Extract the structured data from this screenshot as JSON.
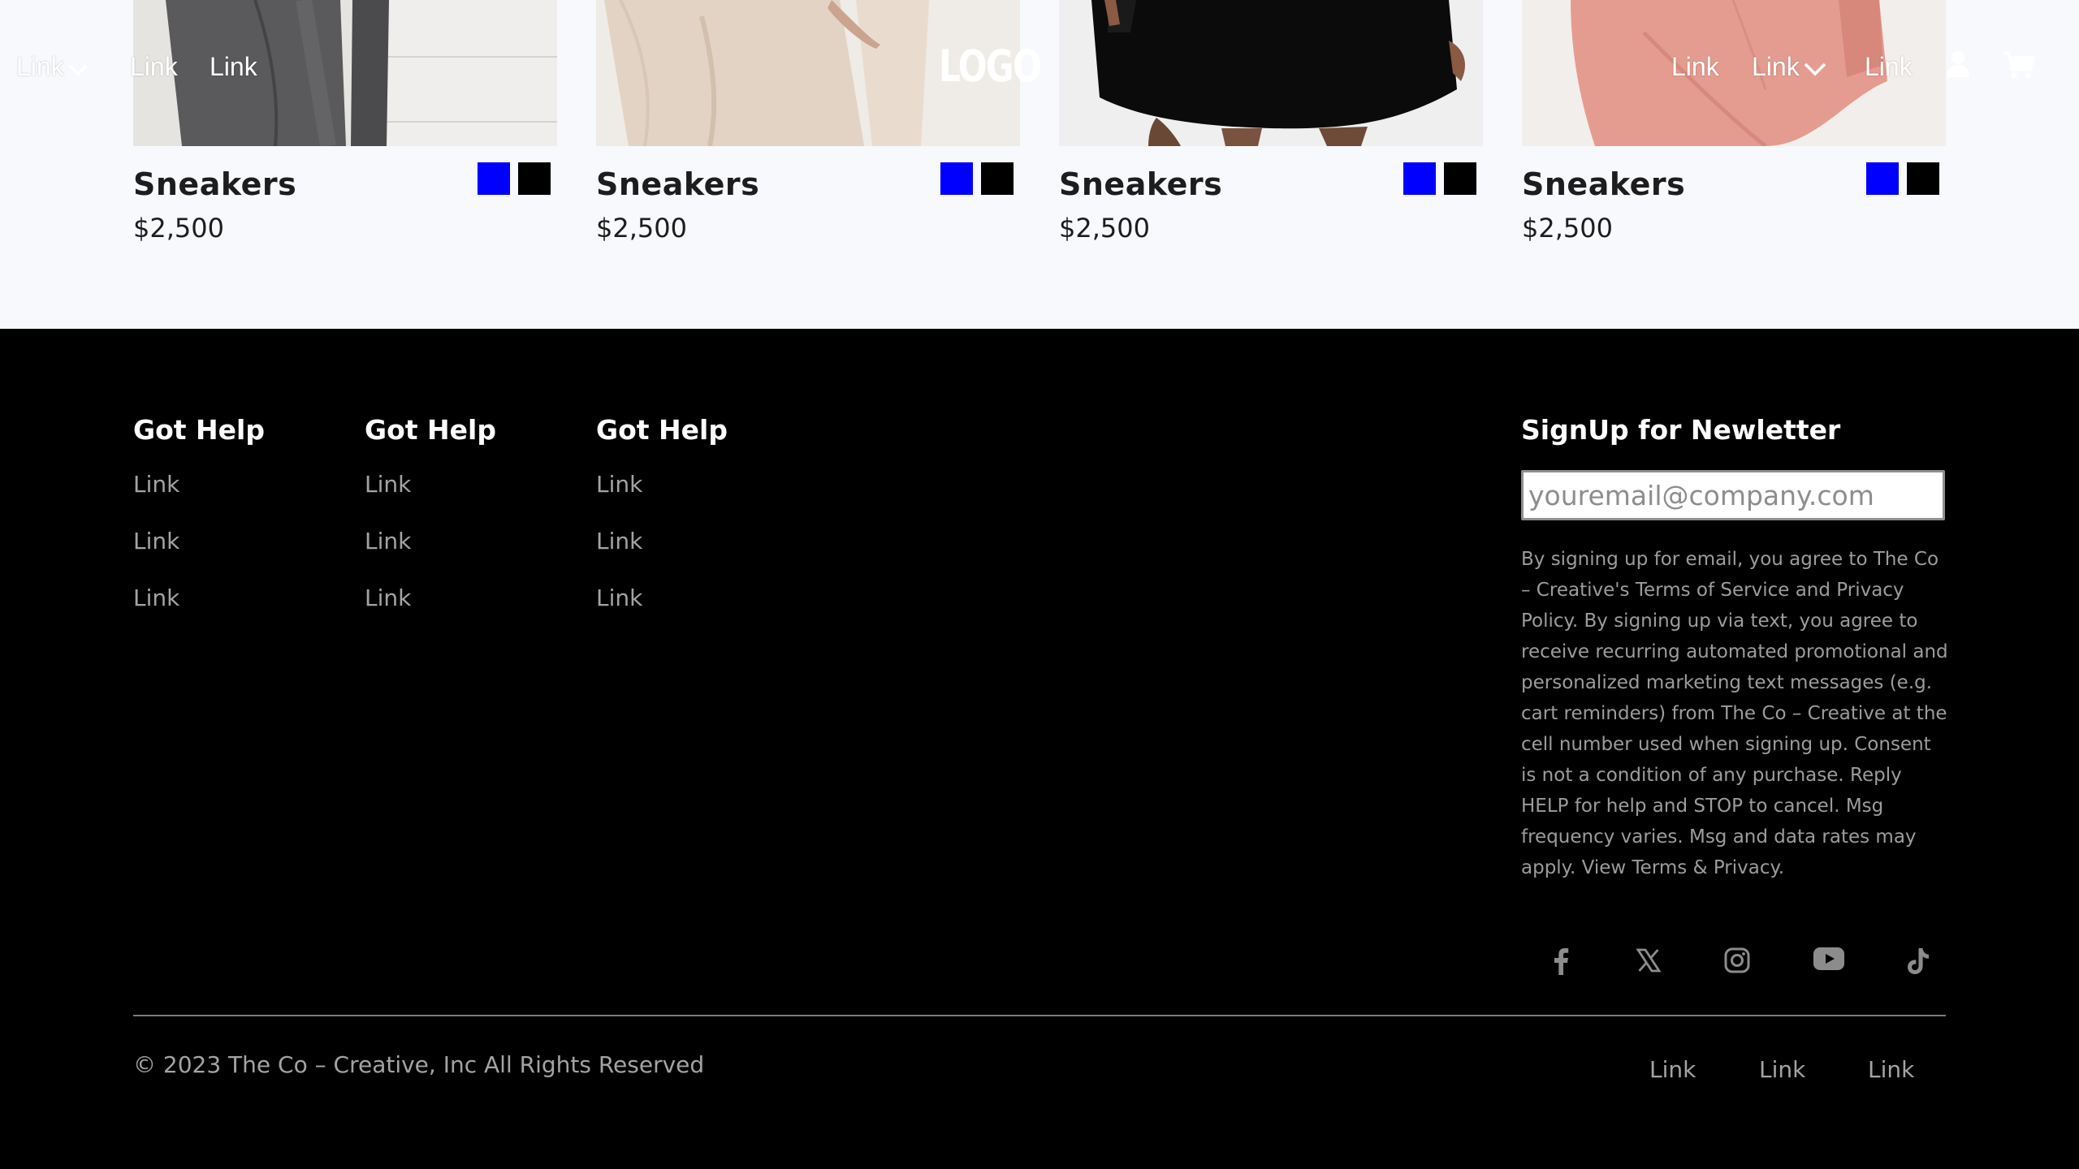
{
  "header": {
    "nav_left": [
      {
        "label": "Link",
        "has_dropdown": true
      },
      {
        "label": "Link",
        "has_dropdown": false
      },
      {
        "label": "Link",
        "has_dropdown": false
      }
    ],
    "logo": "LOGO",
    "nav_right": [
      {
        "label": "Link",
        "has_dropdown": false
      },
      {
        "label": "Link",
        "has_dropdown": true
      },
      {
        "label": "Link",
        "has_dropdown": false
      }
    ],
    "icons": [
      "user-icon",
      "cart-icon"
    ]
  },
  "products": [
    {
      "name": "Sneakers",
      "price": "$2,500",
      "swatches": [
        "#0000ff",
        "#000000"
      ]
    },
    {
      "name": "Sneakers",
      "price": "$2,500",
      "swatches": [
        "#0000ff",
        "#000000"
      ]
    },
    {
      "name": "Sneakers",
      "price": "$2,500",
      "swatches": [
        "#0000ff",
        "#000000"
      ]
    },
    {
      "name": "Sneakers",
      "price": "$2,500",
      "swatches": [
        "#0000ff",
        "#000000"
      ]
    }
  ],
  "footer": {
    "columns": [
      {
        "title": "Got Help",
        "links": [
          "Link",
          "Link",
          "Link"
        ]
      },
      {
        "title": "Got Help",
        "links": [
          "Link",
          "Link",
          "Link"
        ]
      },
      {
        "title": "Got Help",
        "links": [
          "Link",
          "Link",
          "Link"
        ]
      }
    ],
    "newsletter": {
      "title": "SignUp for Newletter",
      "placeholder": "youremail@company.com",
      "legal": "By signing up for email, you agree to The Co – Creative's Terms of Service and Privacy Policy. By signing up via text, you agree to receive recurring automated promotional and personalized marketing text messages (e.g. cart reminders) from The Co – Creative at the cell number used when signing up. Consent is not a condition of any purchase. Reply HELP for help and STOP to cancel. Msg frequency varies. Msg and data rates may apply. View Terms & Privacy."
    },
    "social_icons": [
      "facebook-icon",
      "x-icon",
      "instagram-icon",
      "youtube-icon",
      "tiktok-icon"
    ],
    "copyright": "© 2023 The Co – Creative, Inc All Rights Reserved",
    "bottom_links": [
      "Link",
      "Link",
      "Link"
    ]
  },
  "colors": {
    "product_bg": "#f7f9fc",
    "footer_bg": "#000000",
    "swatch_blue": "#0000ff",
    "swatch_black": "#000000"
  }
}
